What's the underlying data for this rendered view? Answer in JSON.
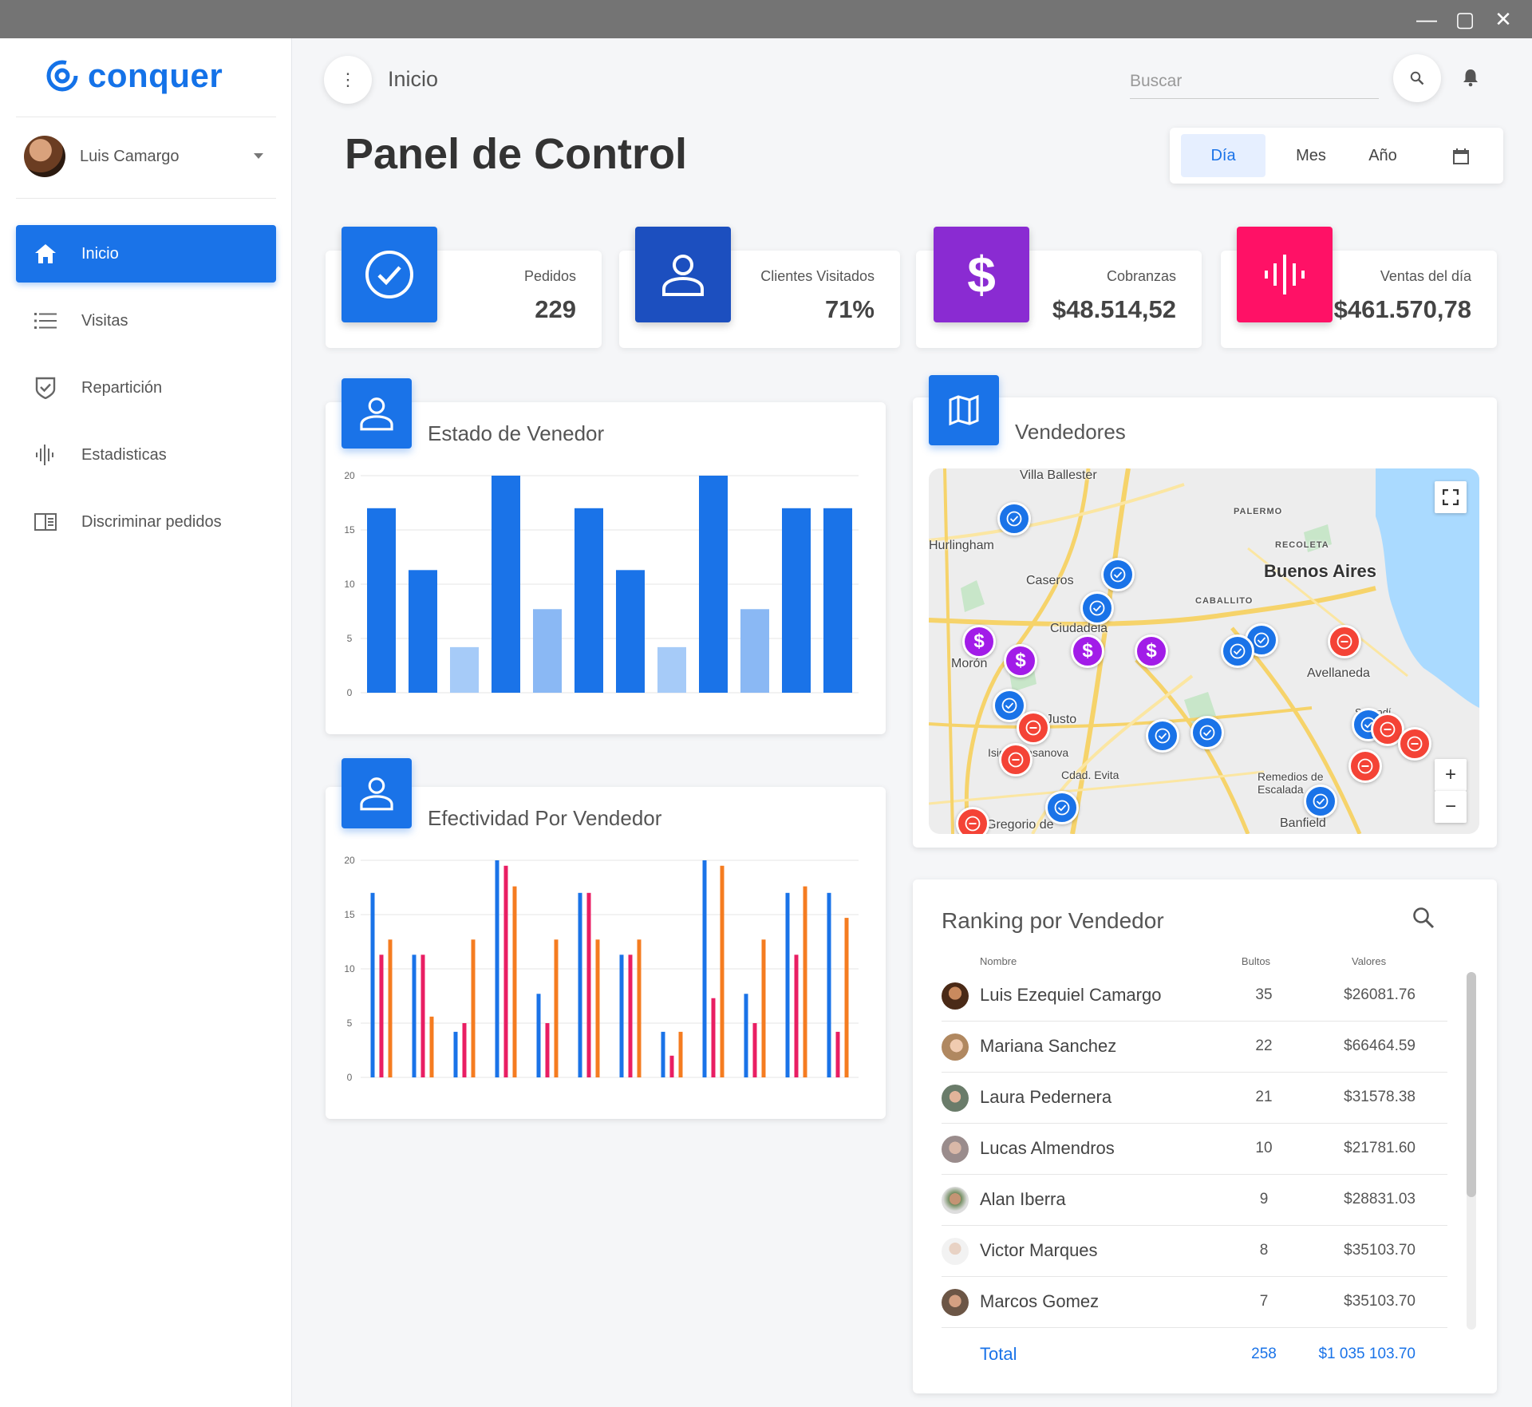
{
  "app": {
    "logo": "conquer",
    "brand_color": "#1472e8",
    "user_name": "Luis Camargo"
  },
  "sidebar": {
    "items": [
      {
        "label": "Inicio",
        "icon": "home-icon",
        "active": true
      },
      {
        "label": "Visitas",
        "icon": "list-icon"
      },
      {
        "label": "Repartición",
        "icon": "shield-check-icon"
      },
      {
        "label": "Estadisticas",
        "icon": "bars-icon"
      },
      {
        "label": "Discriminar pedidos",
        "icon": "book-icon"
      }
    ]
  },
  "header": {
    "breadcrumb": "Inicio",
    "search_placeholder": "Buscar",
    "title": "Panel de Control",
    "range_options": [
      "Día",
      "Mes",
      "Año"
    ],
    "range_selected": "Día"
  },
  "stats": [
    {
      "label": "Pedidos",
      "value": "229",
      "color": "#1a73e8",
      "icon": "check-circle-icon"
    },
    {
      "label": "Clientes Visitados",
      "value": "71%",
      "color": "#1c4fbf",
      "icon": "person-icon"
    },
    {
      "label": "Cobranzas",
      "value": "$48.514,52",
      "color": "#8a2bd2",
      "icon": "dollar-icon"
    },
    {
      "label": "Ventas del día",
      "value": "$461.570,78",
      "color": "#ff1166",
      "icon": "waveform-icon"
    }
  ],
  "chart_data": [
    {
      "type": "bar",
      "title": "Estado de Venedor",
      "ylim": [
        0,
        20
      ],
      "yticks": [
        0,
        5,
        10,
        15,
        20
      ],
      "values": [
        17,
        11.3,
        4.2,
        20,
        7.7,
        17,
        11.3,
        4.2,
        20,
        7.7,
        17,
        17
      ],
      "colors": [
        "#1a73e8",
        "#1a73e8",
        "#a6cbf8",
        "#1a73e8",
        "#8ab8f4",
        "#1a73e8",
        "#1a73e8",
        "#a6cbf8",
        "#1a73e8",
        "#8ab8f4",
        "#1a73e8",
        "#1a73e8"
      ]
    },
    {
      "type": "bar",
      "title": "Efectividad Por Vendedor",
      "ylim": [
        0,
        20
      ],
      "yticks": [
        0,
        5,
        10,
        15,
        20
      ],
      "series": [
        {
          "color": "#1a73e8",
          "values": [
            17,
            11.3,
            4.2,
            20,
            7.7,
            17,
            11.3,
            4.2,
            20,
            7.7,
            17,
            17
          ]
        },
        {
          "color": "#e91e63",
          "values": [
            11.3,
            11.3,
            5,
            19.5,
            5,
            17,
            11.3,
            2,
            7.3,
            5,
            11.3,
            4.2
          ]
        },
        {
          "color": "#f57c20",
          "values": [
            12.7,
            5.6,
            12.7,
            17.6,
            12.7,
            12.7,
            12.7,
            4.2,
            19.5,
            12.7,
            17.6,
            14.7
          ]
        }
      ],
      "series_colors": [
        "#1a73e8",
        "#e91e63",
        "#f57c20"
      ]
    }
  ],
  "map": {
    "title": "Vendedores",
    "places": [
      "Villa Ballester",
      "Hurlingham",
      "Caseros",
      "PALERMO",
      "RECOLETA",
      "Buenos Aires",
      "CABALLITO",
      "Ciudadela",
      "Morón",
      "Avellaneda",
      "San Justo",
      "Isidro Casanova",
      "Cdad. Evita",
      "Remedios de Escalada",
      "Banfield",
      "Sarandí",
      "Gregorio de"
    ],
    "zoom_in": "+",
    "zoom_out": "−"
  },
  "ranking": {
    "title": "Ranking por Vendedor",
    "columns": [
      "Nombre",
      "Bultos",
      "Valores"
    ],
    "rows": [
      {
        "name": "Luis Ezequiel Camargo",
        "qty": "35",
        "value": "$26081.76"
      },
      {
        "name": "Mariana Sanchez",
        "qty": "22",
        "value": "$66464.59"
      },
      {
        "name": "Laura Pedernera",
        "qty": "21",
        "value": "$31578.38"
      },
      {
        "name": "Lucas Almendros",
        "qty": "10",
        "value": "$21781.60"
      },
      {
        "name": "Alan Iberra",
        "qty": "9",
        "value": "$28831.03"
      },
      {
        "name": "Victor Marques",
        "qty": "8",
        "value": "$35103.70"
      },
      {
        "name": "Marcos Gomez",
        "qty": "7",
        "value": "$35103.70"
      }
    ],
    "total": {
      "label": "Total",
      "qty": "258",
      "value": "$1 035 103.70"
    }
  }
}
